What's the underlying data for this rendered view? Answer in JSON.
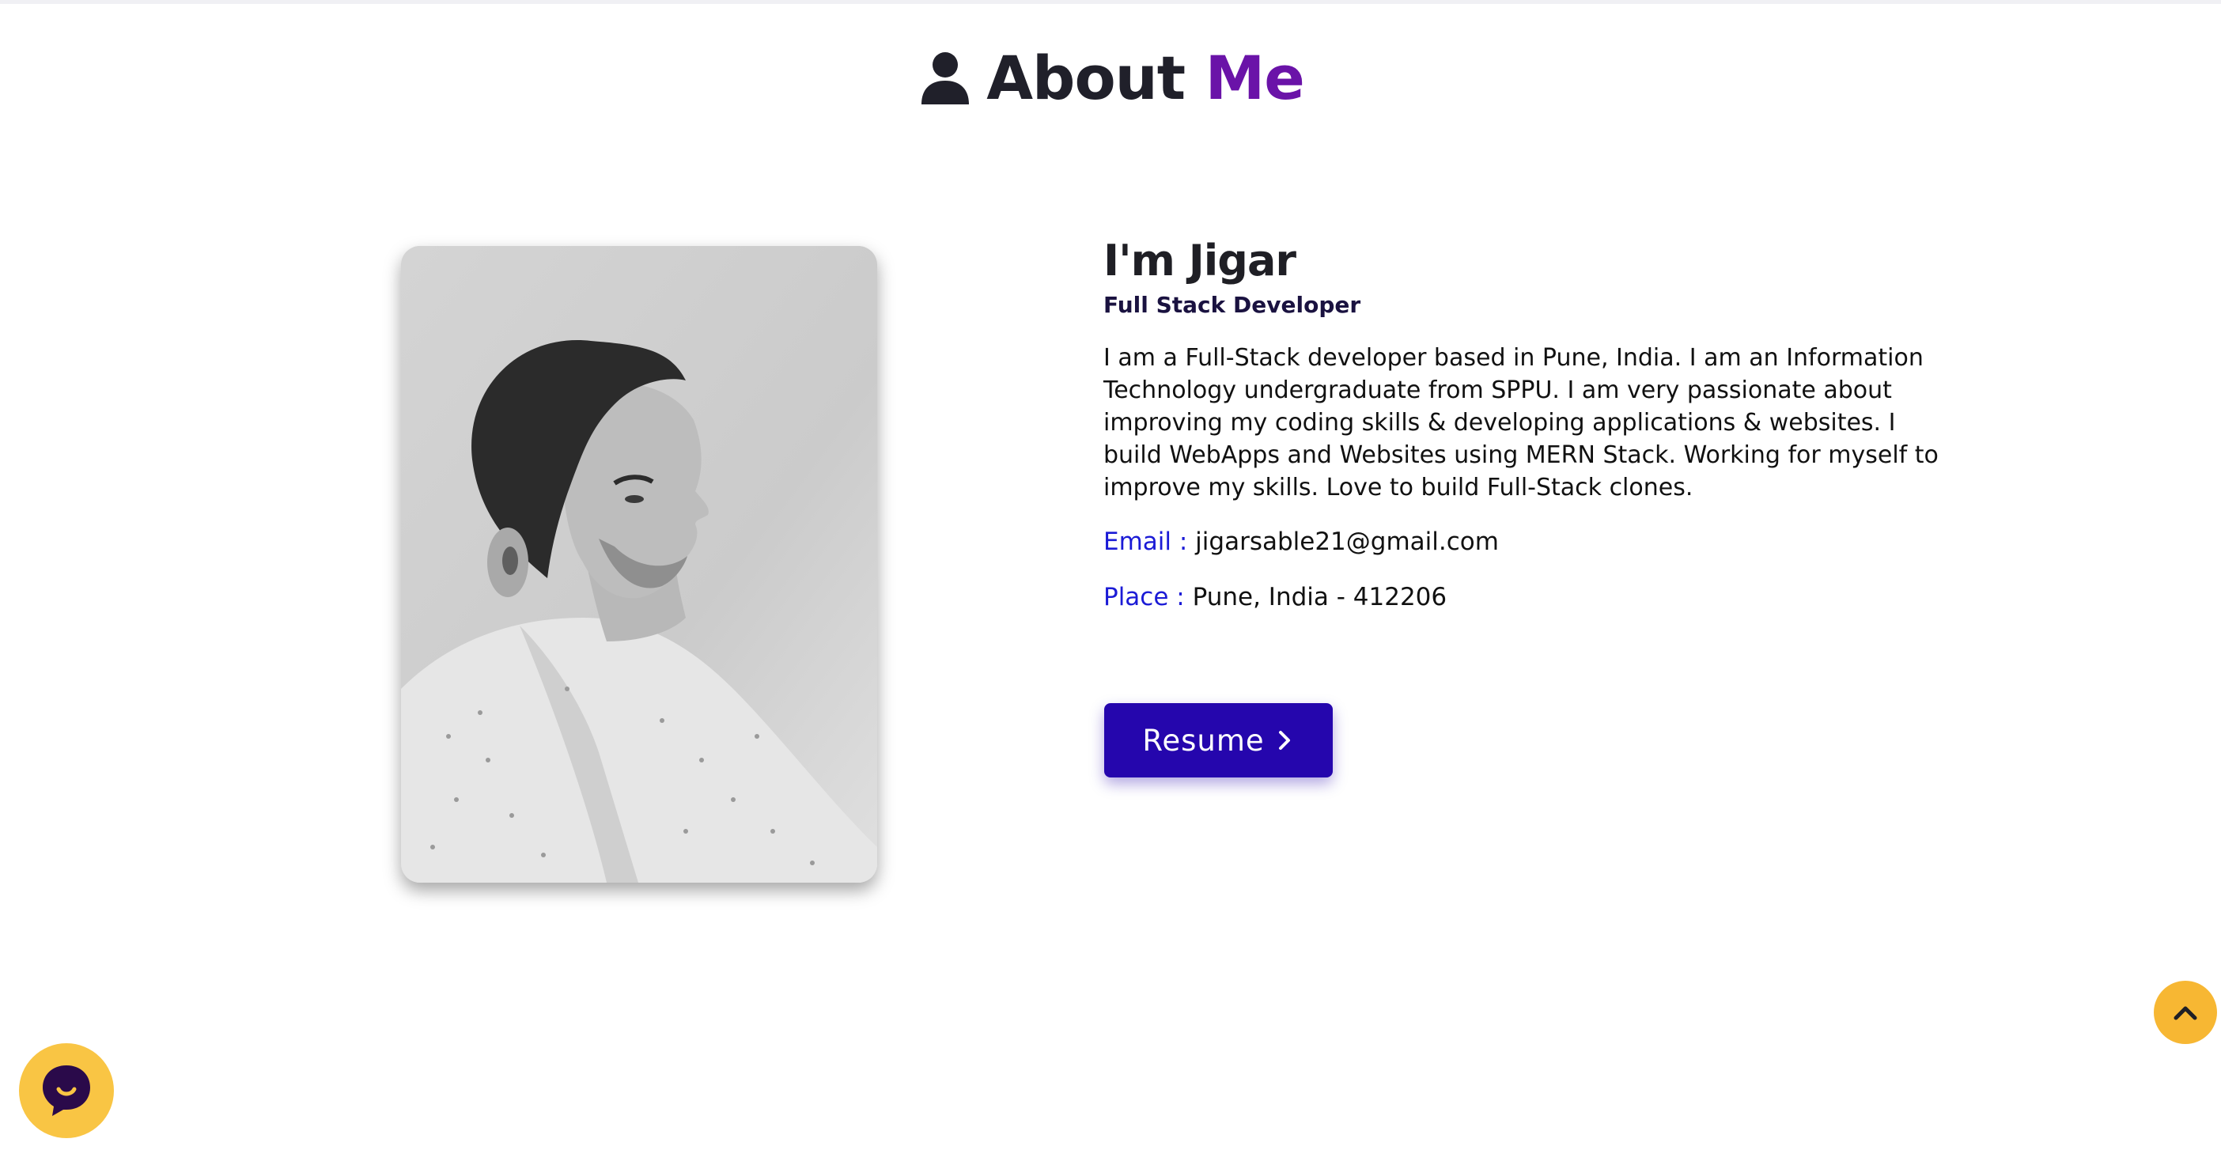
{
  "section": {
    "title_plain": "About",
    "title_accent": "Me",
    "title_icon": "user-icon"
  },
  "profile": {
    "name": "I'm Jigar",
    "role": "Full Stack Developer",
    "bio": "I am a Full-Stack developer based in Pune, India. I am an Information Technology undergraduate from SPPU. I am very passionate about improving my coding skills & developing applications & websites. I build WebApps and Websites using MERN Stack. Working for myself to improve my skills. Love to build Full-Stack clones.",
    "email_label": "Email :",
    "email_value": "jigarsable21@gmail.com",
    "place_label": "Place :",
    "place_value": "Pune, India - 412206",
    "photo_icon": "profile-photo"
  },
  "actions": {
    "resume_label": "Resume",
    "resume_icon": "chevron-right-icon",
    "scroll_top_icon": "chevron-up-icon",
    "chat_icon": "chat-bubble-icon"
  },
  "colors": {
    "accent_purple": "#6a13a8",
    "button_blue": "#2506ad",
    "label_blue": "#1b1bd6",
    "fab_yellow": "#f7b733"
  }
}
